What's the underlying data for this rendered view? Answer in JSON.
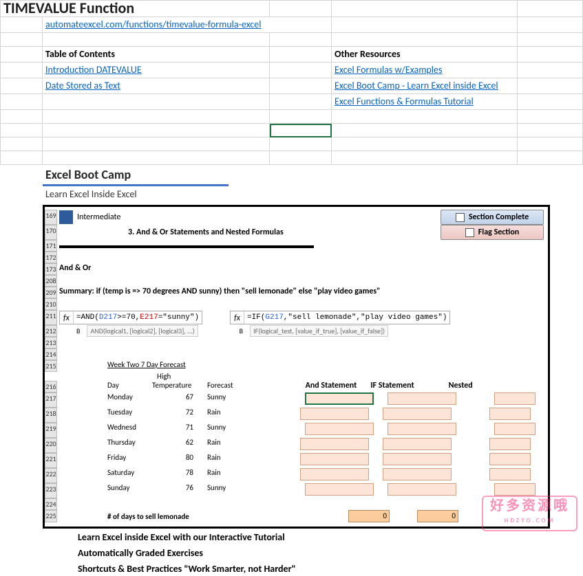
{
  "title": "TIMEVALUE Function",
  "mainLink": "automateexcel.com/functions/timevalue-formula-excel",
  "toc": {
    "header": "Table of Contents",
    "items": [
      "Introduction DATEVALUE",
      "Date Stored as Text"
    ]
  },
  "other": {
    "header": "Other Resources",
    "items": [
      "Excel Formulas w/Examples",
      "Excel Boot Camp - Learn Excel inside Excel",
      "Excel Functions & Formulas Tutorial"
    ]
  },
  "camp": {
    "heading": "Excel Boot Camp",
    "sub": "Learn Excel Inside Excel",
    "level": "Intermediate",
    "chapter": "3. And & Or Statements and Nested Formulas",
    "btnComplete": "Section Complete",
    "btnFlag": "Flag Section",
    "andor": "And & Or",
    "summary": "Summary: if (temp is => 70 degrees AND sunny) then \"sell lemonade\" else \"play video games\"",
    "fx1": {
      "pre": "=AND(",
      "c1": "D217",
      "mid": ">=70,",
      "c2": "E217",
      "post": "=\"sunny\")"
    },
    "fx2": {
      "pre": "=IF(",
      "c1": "G217",
      "post": ",\"sell lemonade\",\"play video games\")"
    },
    "hint1": "AND(logical1, [logical2], [logical3], ...)",
    "hint2": "IF(logical_test, [value_if_true], [value_if_false])",
    "forecastTitle": "Week Two 7 Day Forecast",
    "highLabel": "High",
    "cols": [
      "Day",
      "Temperature",
      "Forecast"
    ],
    "stats": [
      "And Statement",
      "IF Statement",
      "Nested"
    ],
    "rows": [
      {
        "d": "Monday",
        "t": "67",
        "f": "Sunny"
      },
      {
        "d": "Tuesday",
        "t": "72",
        "f": "Rain"
      },
      {
        "d": "Wednesd",
        "t": "71",
        "f": "Sunny"
      },
      {
        "d": "Thursday",
        "t": "62",
        "f": "Rain"
      },
      {
        "d": "Friday",
        "t": "80",
        "f": "Rain"
      },
      {
        "d": "Saturday",
        "t": "78",
        "f": "Rain"
      },
      {
        "d": "Sunday",
        "t": "76",
        "f": "Sunny"
      }
    ],
    "daysLabel": "# of days to sell lemonade",
    "result1": "0",
    "result2": "0",
    "bullets": [
      "Learn Excel inside Excel with our Interactive Tutorial",
      "Automatically Graded Exercises",
      "Shortcuts & Best Practices \"Work Smarter, not Harder\""
    ]
  },
  "rowNums": [
    "169",
    "170",
    "171",
    "172",
    "173",
    "208",
    "209",
    "210",
    "211",
    "212",
    "213",
    "214",
    "215",
    "216",
    "217",
    "218",
    "219",
    "220",
    "221",
    "222",
    "223",
    "224",
    "225"
  ],
  "wm": {
    "main": "好多资源哦",
    "sub": "HDZYO.COM"
  }
}
